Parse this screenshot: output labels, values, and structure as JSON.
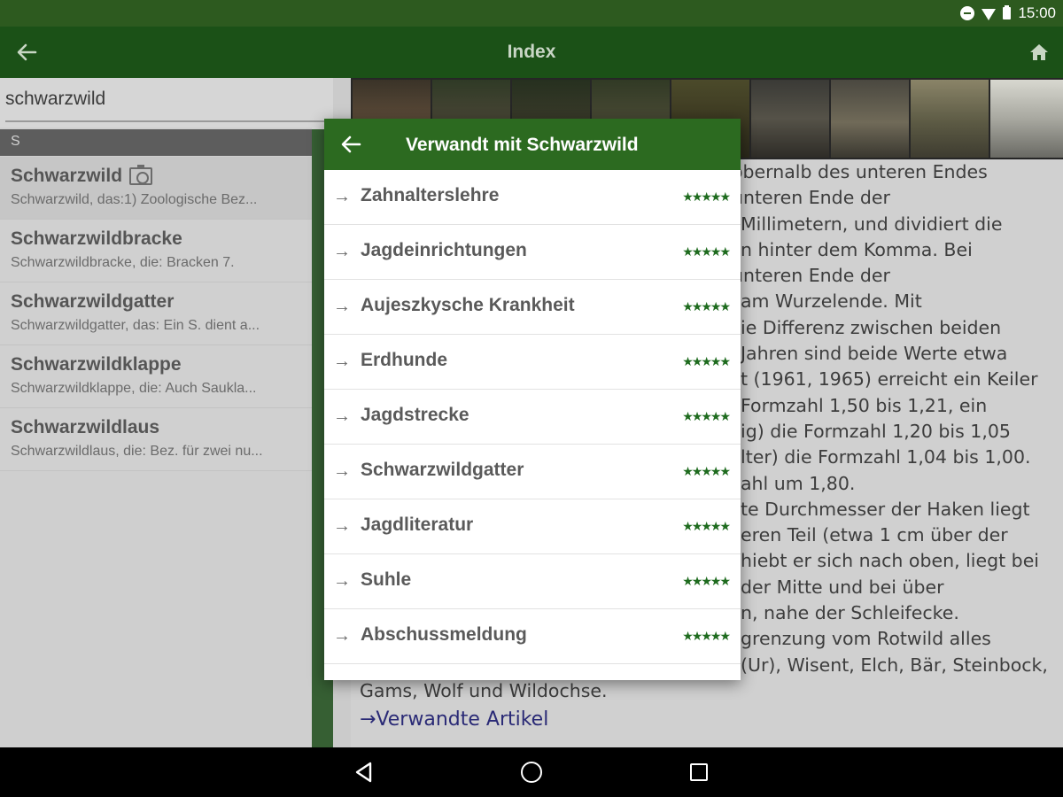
{
  "status_bar": {
    "time": "15:00"
  },
  "appbar": {
    "title": "Index",
    "back_icon": "arrow-back-icon",
    "home_icon": "home-icon"
  },
  "search": {
    "value": "schwarzwild"
  },
  "section_header": "S",
  "list": [
    {
      "title": "Schwarzwild",
      "subtitle": "Schwarzwild, das:1) Zoologische Bez...",
      "has_camera": true
    },
    {
      "title": "Schwarzwildbracke",
      "subtitle": "Schwarzwildbracke, die: Bracken 7."
    },
    {
      "title": "Schwarzwildgatter",
      "subtitle": "Schwarzwildgatter, das: Ein S. dient a..."
    },
    {
      "title": "Schwarzwildklappe",
      "subtitle": "Schwarzwildklappe, die: Auch Sauklа..."
    },
    {
      "title": "Schwarzwildlaus",
      "subtitle": "Schwarzwildlaus, die: Bez. für zwei nu..."
    }
  ],
  "article": {
    "lines": [
      "obernalb des unteren Endes",
      "unteren Ende der",
      "Millimetern, und dividiert die",
      "n hinter dem Komma. Bei",
      "unteren Ende der",
      "am Wurzelende. Mit",
      "ie Differenz zwischen beiden",
      "Jahren sind beide Werte etwa",
      "t (1961, 1965) erreicht ein Keiler",
      "Formzahl 1,50 bis 1,21, ein",
      "ig) die Formzahl 1,20 bis 1,05",
      "lter) die Formzahl 1,04 bis 1,00.",
      "ahl um 1,80.",
      "te Durchmesser der Haken liegt",
      "eren Teil (etwa 1 cm über der",
      "hiebt er sich nach oben, liegt bei",
      "der Mitte und bei über",
      "n, nahe der Schleifecke.",
      "grenzung vom Rotwild alles",
      "(Ur), Wisent, Elch, Bär, Steinbock,",
      "Gams, Wolf und Wildochse."
    ],
    "related_link": "→Verwandte Artikel"
  },
  "dialog": {
    "title": "Verwandt mit Schwarzwild",
    "items": [
      {
        "label": "Zahnalterslehre",
        "stars": "★★★★★"
      },
      {
        "label": "Jagdeinrichtungen",
        "stars": "★★★★★"
      },
      {
        "label": "Aujeszkysche Krankheit",
        "stars": "★★★★★"
      },
      {
        "label": "Erdhunde",
        "stars": "★★★★★"
      },
      {
        "label": "Jagdstrecke",
        "stars": "★★★★★"
      },
      {
        "label": "Schwarzwildgatter",
        "stars": "★★★★★"
      },
      {
        "label": "Jagdliteratur",
        "stars": "★★★★★"
      },
      {
        "label": "Suhle",
        "stars": "★★★★★"
      },
      {
        "label": "Abschussmeldung",
        "stars": "★★★★★"
      }
    ]
  },
  "colors": {
    "status_bar": "#2d5a1f",
    "app_bar": "#1b5117",
    "dialog_header": "#2c6a20",
    "stars": "#1e6b1e"
  }
}
